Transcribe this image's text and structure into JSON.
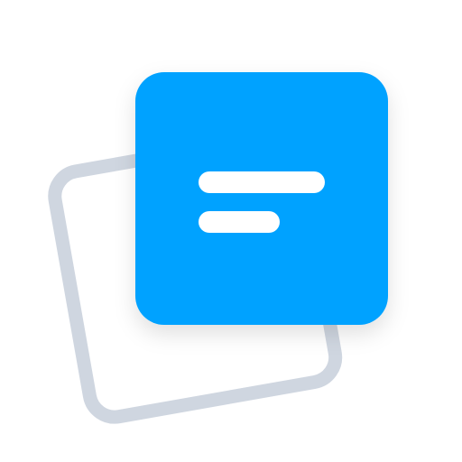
{
  "icon": {
    "name": "stacked-notes-icon",
    "colors": {
      "background": "#ffffff",
      "back_card_stroke": "#cfd6e0",
      "front_card_fill": "#00a2ff",
      "lines": "#ffffff"
    }
  }
}
